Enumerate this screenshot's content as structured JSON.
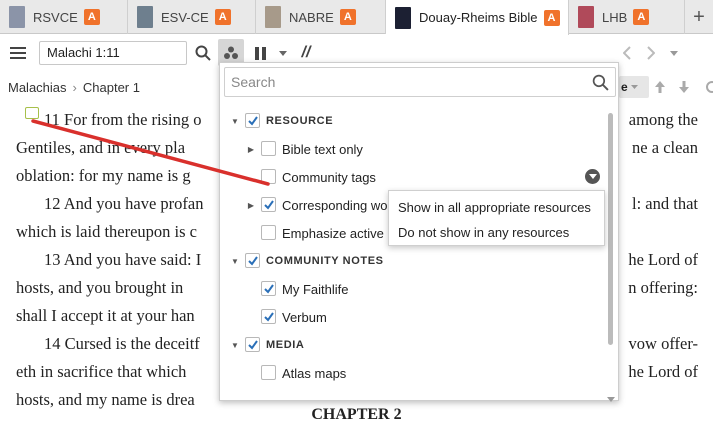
{
  "tabs": [
    {
      "label": "RSVCE",
      "badge": "A",
      "thumb_color": "#8b94a8",
      "active": false
    },
    {
      "label": "ESV-CE",
      "badge": "A",
      "thumb_color": "#6e7f8e",
      "active": false
    },
    {
      "label": "NABRE",
      "badge": "A",
      "thumb_color": "#a79a8a",
      "active": false
    },
    {
      "label": "Douay-Rheims Bible",
      "badge": "A",
      "thumb_color": "#1c2033",
      "active": true
    },
    {
      "label": "LHB",
      "badge": "A",
      "thumb_color": "#b04a5a",
      "active": false
    }
  ],
  "toolbar": {
    "reference": "Malachi 1:11",
    "parallel_symbol": "//"
  },
  "breadcrumb": {
    "book": "Malachias",
    "chapter": "Chapter 1",
    "right_partial": "e"
  },
  "content": {
    "lines": [
      "11 For from the rising o",
      "among the",
      "Gentiles, and in every pla",
      "ne a clean",
      "oblation: for my name is g",
      "12 And you have profan",
      "l: and that",
      "which is laid thereupon is c",
      "13 And you have said: I",
      "he Lord of",
      "hosts, and you brought in",
      "n offering:",
      "shall I accept it at your han",
      "14 Cursed is the deceitf",
      "vow offer-",
      "eth in sacrifice that which",
      "he Lord of",
      "hosts, and my name is drea"
    ],
    "next_chapter": "CHAPTER 2"
  },
  "panel": {
    "search_placeholder": "Search",
    "rows": [
      {
        "label": "RESOURCE",
        "caps": true,
        "checked": true,
        "caret": "down"
      },
      {
        "label": "Bible text only",
        "caps": false,
        "checked": false,
        "caret": "right"
      },
      {
        "label": "Community tags",
        "caps": false,
        "checked": false,
        "caret": ""
      },
      {
        "label": "Corresponding wo",
        "caps": false,
        "checked": true,
        "caret": "right"
      },
      {
        "label": "Emphasize active l",
        "caps": false,
        "checked": false,
        "caret": ""
      },
      {
        "label": "COMMUNITY NOTES",
        "caps": true,
        "checked": true,
        "caret": "down"
      },
      {
        "label": "My Faithlife",
        "caps": false,
        "checked": true,
        "caret": ""
      },
      {
        "label": "Verbum",
        "caps": false,
        "checked": true,
        "caret": ""
      },
      {
        "label": "MEDIA",
        "caps": true,
        "checked": true,
        "caret": "down"
      },
      {
        "label": "Atlas maps",
        "caps": false,
        "checked": false,
        "caret": ""
      }
    ]
  },
  "context_menu": {
    "items": [
      "Show in all appropriate resources",
      "Do not show in any resources"
    ]
  },
  "colors": {
    "badge": "#f0722b",
    "check": "#2a6fb8",
    "annotation_line": "#d9302c",
    "note_marker": "#a7c04a"
  }
}
